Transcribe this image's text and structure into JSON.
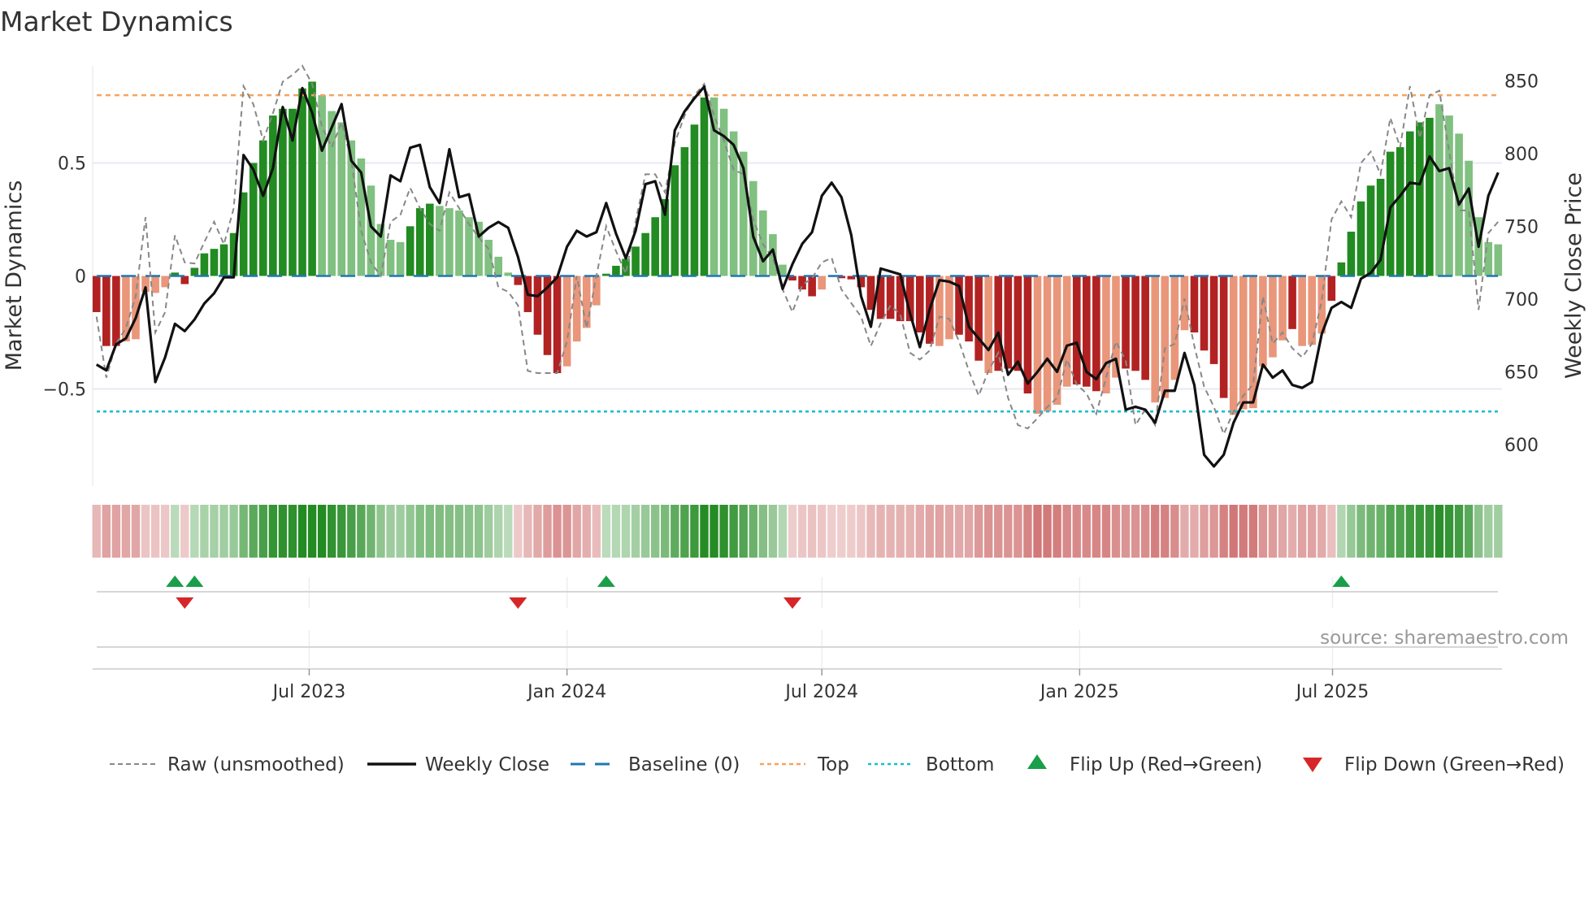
{
  "title": "Market Dynamics",
  "source": "source: sharemaestro.com",
  "chart_data": {
    "type": "bar",
    "title": "Market Dynamics",
    "ylabel": "Market Dynamics",
    "ylabel_right": "Weekly Close Price",
    "ylim": [
      -0.93,
      0.93
    ],
    "ylim_right": [
      571.5,
      860.3
    ],
    "yticks": [
      {
        "v": 0.5,
        "label": "0.5"
      },
      {
        "v": 0,
        "label": "0"
      },
      {
        "v": -0.5,
        "label": "−0.5"
      }
    ],
    "yticks_right": [
      {
        "v": 850,
        "label": "850"
      },
      {
        "v": 800,
        "label": "800"
      },
      {
        "v": 750,
        "label": "750"
      },
      {
        "v": 700,
        "label": "700"
      },
      {
        "v": 650,
        "label": "650"
      },
      {
        "v": 600,
        "label": "600"
      }
    ],
    "x_unit": "week index",
    "xticks": [
      {
        "week": 21.7,
        "label": "Jul 2023"
      },
      {
        "week": 48.0,
        "label": "Jan 2024"
      },
      {
        "week": 74.0,
        "label": "Jul 2024"
      },
      {
        "week": 100.3,
        "label": "Jan 2025"
      },
      {
        "week": 126.1,
        "label": "Jul 2025"
      }
    ],
    "levels": {
      "top": 0.8,
      "bottom": -0.6,
      "baseline": 0
    },
    "series": [
      {
        "name": "Market Dynamics (bars)",
        "values": [
          -0.16,
          -0.31,
          -0.31,
          -0.29,
          -0.28,
          -0.07,
          -0.075,
          -0.05,
          0.015,
          -0.036,
          0.036,
          0.1,
          0.12,
          0.14,
          0.19,
          0.37,
          0.5,
          0.6,
          0.71,
          0.74,
          0.74,
          0.83,
          0.86,
          0.8,
          0.73,
          0.68,
          0.6,
          0.52,
          0.4,
          0.23,
          0.16,
          0.15,
          0.22,
          0.3,
          0.32,
          0.31,
          0.3,
          0.29,
          0.26,
          0.24,
          0.16,
          0.085,
          0.015,
          -0.04,
          -0.16,
          -0.26,
          -0.35,
          -0.43,
          -0.4,
          -0.29,
          -0.23,
          -0.13,
          0.01,
          0.045,
          0.076,
          0.13,
          0.19,
          0.26,
          0.34,
          0.49,
          0.57,
          0.67,
          0.79,
          0.79,
          0.74,
          0.64,
          0.55,
          0.42,
          0.29,
          0.185,
          0.05,
          -0.02,
          -0.06,
          -0.09,
          -0.06,
          -0.005,
          -0.01,
          -0.015,
          -0.05,
          -0.15,
          -0.19,
          -0.19,
          -0.2,
          -0.2,
          -0.25,
          -0.3,
          -0.31,
          -0.28,
          -0.26,
          -0.29,
          -0.375,
          -0.43,
          -0.42,
          -0.41,
          -0.42,
          -0.52,
          -0.61,
          -0.6,
          -0.57,
          -0.49,
          -0.48,
          -0.49,
          -0.51,
          -0.52,
          -0.45,
          -0.41,
          -0.42,
          -0.46,
          -0.56,
          -0.54,
          -0.46,
          -0.24,
          -0.25,
          -0.33,
          -0.39,
          -0.54,
          -0.615,
          -0.59,
          -0.585,
          -0.4,
          -0.36,
          -0.285,
          -0.235,
          -0.31,
          -0.305,
          -0.255,
          -0.11,
          0.06,
          0.196,
          0.33,
          0.4,
          0.43,
          0.55,
          0.57,
          0.64,
          0.68,
          0.7,
          0.76,
          0.71,
          0.63,
          0.51,
          0.26,
          0.15,
          0.14
        ],
        "shade": "DDDLLLLLDDDDDDDDDDDDDDDLLLLLLLLLDDDLLLLLLLLDDDDDLLLLDDDDDDDDDDDLLLLLLLLDDDLLDDDDDDDDDDLLDDDLDDDDLLLLDDDLLDDDLLLLDDDDLLLLLLDLLLDDDDDDDDDDDLLLLLL"
      },
      {
        "name": "Raw (unsmoothed)",
        "values": [
          -0.18,
          -0.45,
          -0.3,
          -0.23,
          -0.09,
          0.26,
          -0.25,
          -0.16,
          0.18,
          0.06,
          0.055,
          0.15,
          0.24,
          0.14,
          0.3,
          0.84,
          0.76,
          0.6,
          0.72,
          0.86,
          0.89,
          0.93,
          0.85,
          0.66,
          0.57,
          0.68,
          0.51,
          0.2,
          0.06,
          0.0,
          0.24,
          0.27,
          0.39,
          0.3,
          0.23,
          0.2,
          0.37,
          0.3,
          0.23,
          0.17,
          0.12,
          -0.05,
          -0.07,
          -0.13,
          -0.42,
          -0.43,
          -0.43,
          -0.43,
          -0.29,
          0.0,
          -0.23,
          0.0,
          0.22,
          0.11,
          0.01,
          0.24,
          0.45,
          0.45,
          0.37,
          0.59,
          0.71,
          0.8,
          0.85,
          0.71,
          0.6,
          0.47,
          0.45,
          0.25,
          0.14,
          0.08,
          -0.06,
          -0.16,
          -0.04,
          -0.01,
          0.06,
          0.08,
          -0.06,
          -0.12,
          -0.18,
          -0.31,
          -0.21,
          -0.13,
          -0.17,
          -0.34,
          -0.37,
          -0.33,
          -0.18,
          -0.19,
          -0.29,
          -0.42,
          -0.53,
          -0.42,
          -0.34,
          -0.54,
          -0.66,
          -0.675,
          -0.63,
          -0.58,
          -0.54,
          -0.37,
          -0.48,
          -0.52,
          -0.61,
          -0.45,
          -0.29,
          -0.375,
          -0.66,
          -0.59,
          -0.66,
          -0.32,
          -0.3,
          -0.1,
          -0.31,
          -0.49,
          -0.58,
          -0.7,
          -0.6,
          -0.53,
          -0.48,
          -0.09,
          -0.3,
          -0.25,
          -0.32,
          -0.36,
          -0.3,
          -0.11,
          0.25,
          0.33,
          0.26,
          0.5,
          0.55,
          0.45,
          0.7,
          0.57,
          0.84,
          0.61,
          0.8,
          0.82,
          0.55,
          0.29,
          0.29,
          -0.15,
          0.19,
          0.24
        ]
      },
      {
        "name": "Weekly Close",
        "axis": "right",
        "values": [
          655,
          651,
          669,
          673,
          687,
          708,
          643,
          660,
          683,
          678,
          686,
          697,
          704,
          715,
          715,
          799,
          789,
          771,
          790,
          832,
          809,
          845,
          828,
          802,
          818,
          834,
          795,
          787,
          750,
          743,
          785,
          781,
          804,
          806,
          777,
          766,
          803,
          770,
          772,
          743,
          749,
          753,
          749,
          729,
          703,
          702,
          708,
          715,
          736,
          747,
          743,
          746,
          766,
          745,
          728,
          747,
          779,
          781,
          758,
          816,
          829,
          838,
          846,
          816,
          812,
          806,
          790,
          743,
          726,
          734,
          707,
          724,
          738,
          746,
          771,
          780,
          770,
          744,
          702,
          681,
          721,
          719,
          717,
          690,
          667,
          693,
          713,
          712,
          709,
          681,
          673,
          665,
          677,
          648,
          657,
          642,
          650,
          659,
          650,
          668,
          670,
          650,
          645,
          656,
          659,
          624,
          626,
          624,
          615,
          637,
          637,
          663,
          641,
          593,
          585,
          593,
          615,
          629,
          629,
          655,
          646,
          651,
          641,
          639,
          643,
          676,
          694,
          698,
          694,
          714,
          718,
          727,
          763,
          771,
          780,
          779,
          798,
          788,
          790,
          765,
          776,
          736,
          771,
          787
        ]
      }
    ],
    "flips_up_weeks": [
      8,
      10,
      52,
      127
    ],
    "flips_down_weeks": [
      9,
      43,
      71
    ],
    "legend_position": "bottom",
    "legend": [
      {
        "key": "raw",
        "label": "Raw (unsmoothed)"
      },
      {
        "key": "close",
        "label": "Weekly Close"
      },
      {
        "key": "baseline",
        "label": "Baseline (0)"
      },
      {
        "key": "top",
        "label": "Top"
      },
      {
        "key": "bottom",
        "label": "Bottom"
      },
      {
        "key": "up",
        "label": "Flip Up (Red→Green)"
      },
      {
        "key": "down",
        "label": "Flip Down (Green→Red)"
      }
    ],
    "colors": {
      "pos_dark": "#228b22",
      "pos_light": "#80c080",
      "neg_dark": "#b22222",
      "neg_light": "#e9967a",
      "close": "#111111",
      "raw": "#888888",
      "baseline": "#1f77b4",
      "top": "#f4a460",
      "bottom": "#17becf",
      "flip_up": "#1a9e4a",
      "flip_down": "#d62728"
    }
  }
}
